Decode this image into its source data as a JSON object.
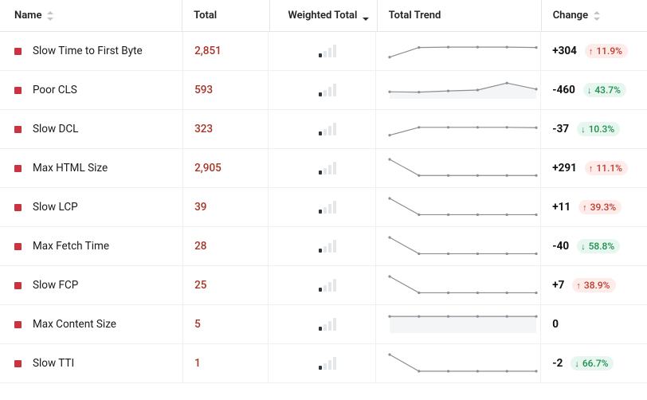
{
  "headers": {
    "name": "Name",
    "total": "Total",
    "weighted": "Weighted Total",
    "trend": "Total Trend",
    "change": "Change"
  },
  "colors": {
    "danger": "#cc3340",
    "pill_up_fg": "#c0392b",
    "pill_up_bg": "#fdecea",
    "pill_down_fg": "#1e8e4f",
    "pill_down_bg": "#e7f6ee"
  },
  "chart_data": [
    {
      "type": "table",
      "note": "Sparkline y-values normalized 0-1; weighted_bars = count of filled bars out of 4"
    }
  ],
  "rows": [
    {
      "name": "Slow Time to First Byte",
      "total": "2,851",
      "weighted_bars": 1,
      "change": "+304",
      "pct": "11.9%",
      "dir": "up",
      "spark": [
        0.85,
        0.3,
        0.28,
        0.28,
        0.28,
        0.3
      ]
    },
    {
      "name": "Poor CLS",
      "total": "593",
      "weighted_bars": 1,
      "change": "-460",
      "pct": "43.7%",
      "dir": "down",
      "spark": [
        0.6,
        0.62,
        0.55,
        0.5,
        0.1,
        0.45
      ]
    },
    {
      "name": "Slow DCL",
      "total": "323",
      "weighted_bars": 1,
      "change": "-37",
      "pct": "10.3%",
      "dir": "down",
      "spark": [
        0.85,
        0.4,
        0.4,
        0.4,
        0.4,
        0.42
      ]
    },
    {
      "name": "Max HTML Size",
      "total": "2,905",
      "weighted_bars": 1,
      "change": "+291",
      "pct": "11.1%",
      "dir": "up",
      "spark": [
        0.0,
        0.92,
        0.92,
        0.92,
        0.92,
        0.92
      ]
    },
    {
      "name": "Slow LCP",
      "total": "39",
      "weighted_bars": 1,
      "change": "+11",
      "pct": "39.3%",
      "dir": "up",
      "spark": [
        0.0,
        0.93,
        0.93,
        0.93,
        0.93,
        0.93
      ]
    },
    {
      "name": "Max Fetch Time",
      "total": "28",
      "weighted_bars": 1,
      "change": "-40",
      "pct": "58.8%",
      "dir": "down",
      "spark": [
        0.0,
        0.93,
        0.93,
        0.93,
        0.93,
        0.93
      ]
    },
    {
      "name": "Slow FCP",
      "total": "25",
      "weighted_bars": 1,
      "change": "+7",
      "pct": "38.9%",
      "dir": "up",
      "spark": [
        0.0,
        0.93,
        0.93,
        0.93,
        0.93,
        0.93
      ]
    },
    {
      "name": "Max Content Size",
      "total": "5",
      "weighted_bars": 1,
      "change": "0",
      "pct": "",
      "dir": "none",
      "spark": [
        0.05,
        0.05,
        0.05,
        0.05,
        0.05,
        0.05
      ],
      "spark_fill": true
    },
    {
      "name": "Slow TTI",
      "total": "1",
      "weighted_bars": 1,
      "change": "-2",
      "pct": "66.7%",
      "dir": "down",
      "spark": [
        0.0,
        0.95,
        0.95,
        0.95,
        0.95,
        0.95
      ]
    }
  ]
}
